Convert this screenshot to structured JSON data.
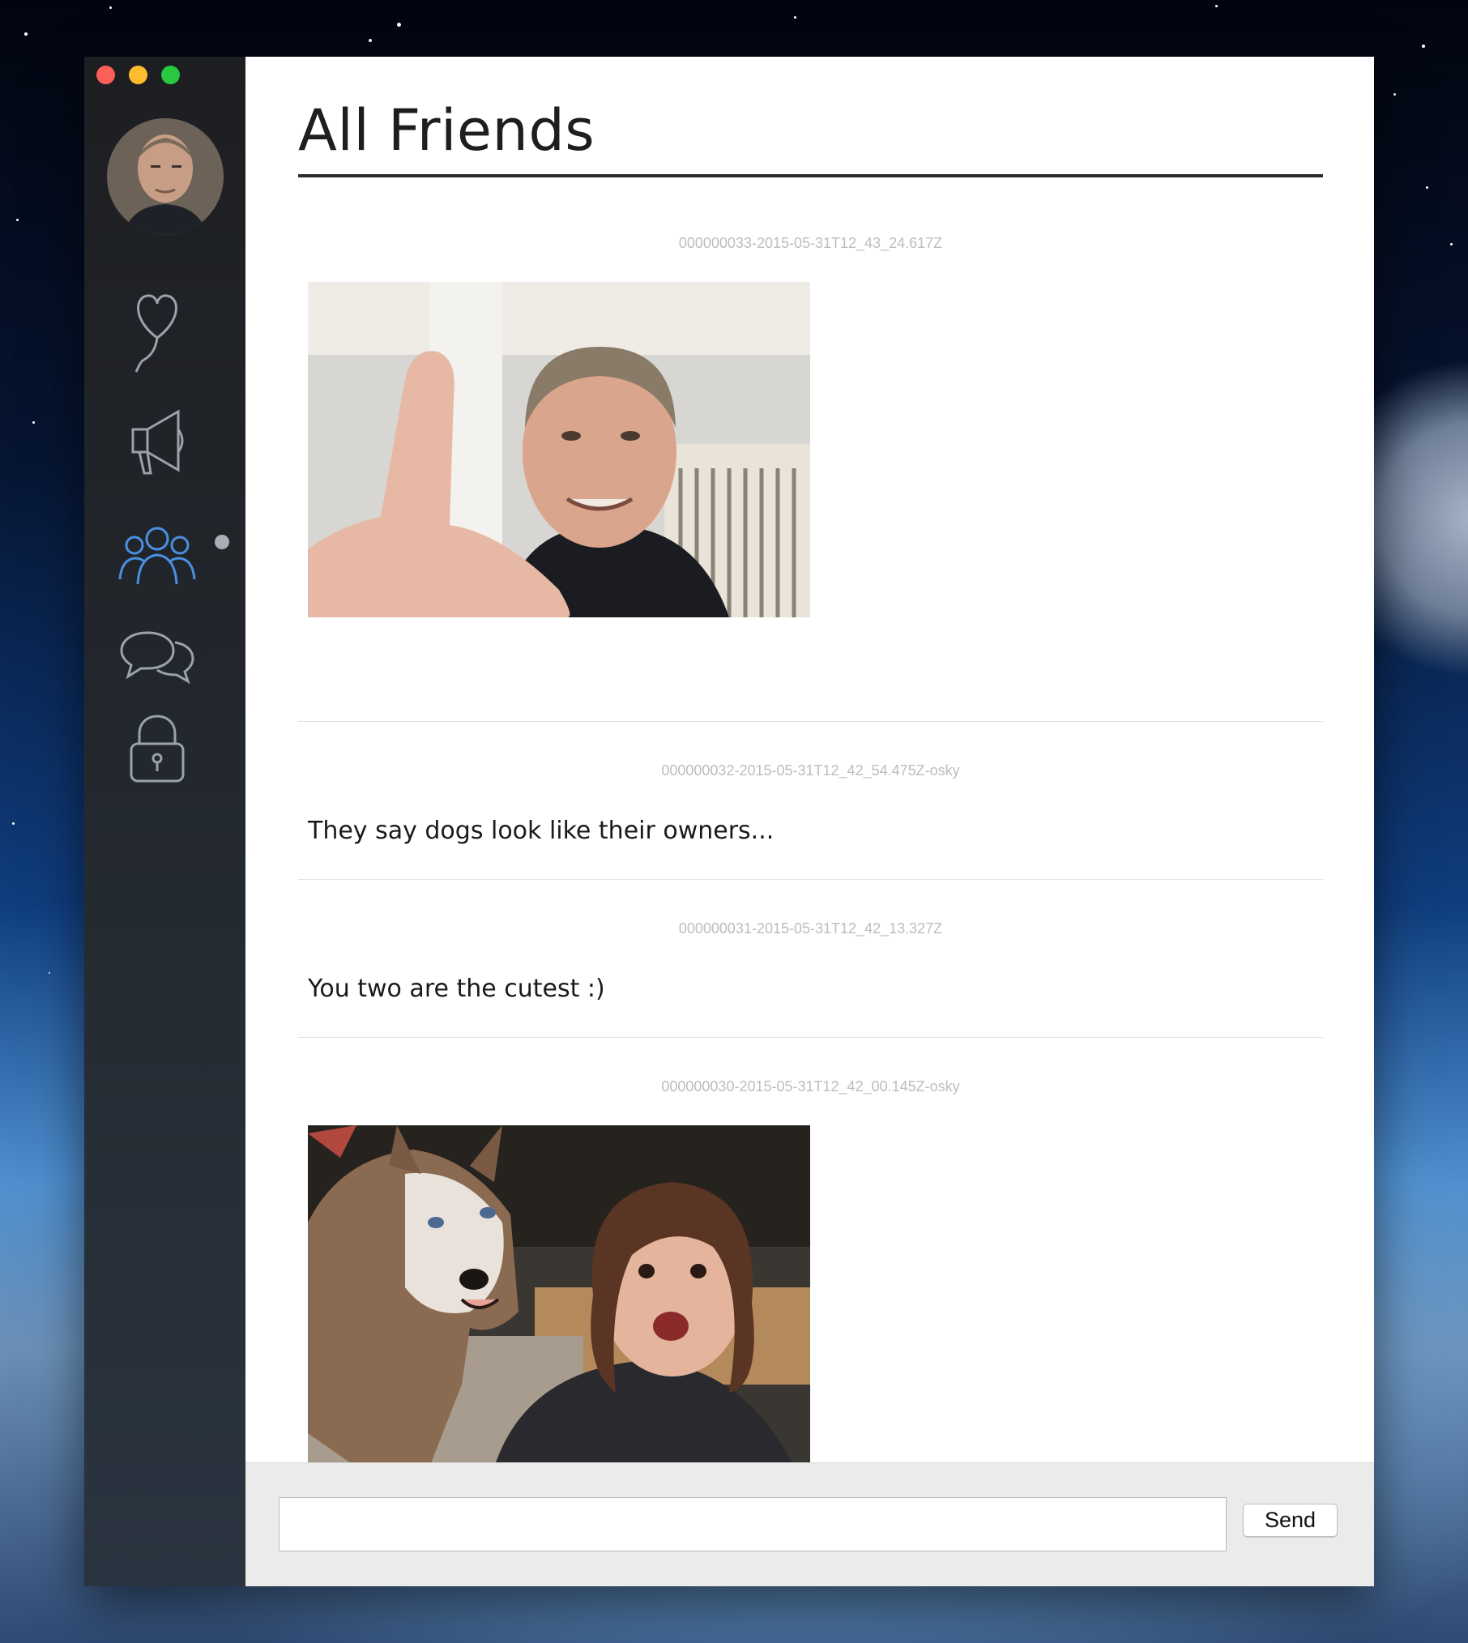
{
  "colors": {
    "sidebar_bg": "#1f2226",
    "nav_icon": "#9aa2ac",
    "nav_icon_active": "#4a90e2",
    "title_rule": "#2b2b2b",
    "timestamp": "#bdbdbd"
  },
  "window": {
    "controls": [
      "close",
      "minimize",
      "maximize"
    ]
  },
  "sidebar": {
    "avatar": "user-avatar",
    "items": [
      {
        "icon": "heart-balloon-icon",
        "active": false
      },
      {
        "icon": "megaphone-icon",
        "active": false
      },
      {
        "icon": "friends-group-icon",
        "active": true
      },
      {
        "icon": "chat-bubbles-icon",
        "active": false
      },
      {
        "icon": "lock-icon",
        "active": false
      }
    ]
  },
  "main": {
    "title": "All Friends",
    "messages": [
      {
        "id": "000000033-2015-05-31T12_43_24.617Z",
        "type": "image",
        "image": "photo-man-thumbs-up"
      },
      {
        "id": "000000032-2015-05-31T12_42_54.475Z-osky",
        "type": "text",
        "text": "They say dogs look like their owners..."
      },
      {
        "id": "000000031-2015-05-31T12_42_13.327Z",
        "type": "text",
        "text": "You two are the cutest :)"
      },
      {
        "id": "000000030-2015-05-31T12_42_00.145Z-osky",
        "type": "image",
        "image": "photo-husky-and-woman"
      }
    ]
  },
  "composer": {
    "input_value": "",
    "send_label": "Send"
  }
}
